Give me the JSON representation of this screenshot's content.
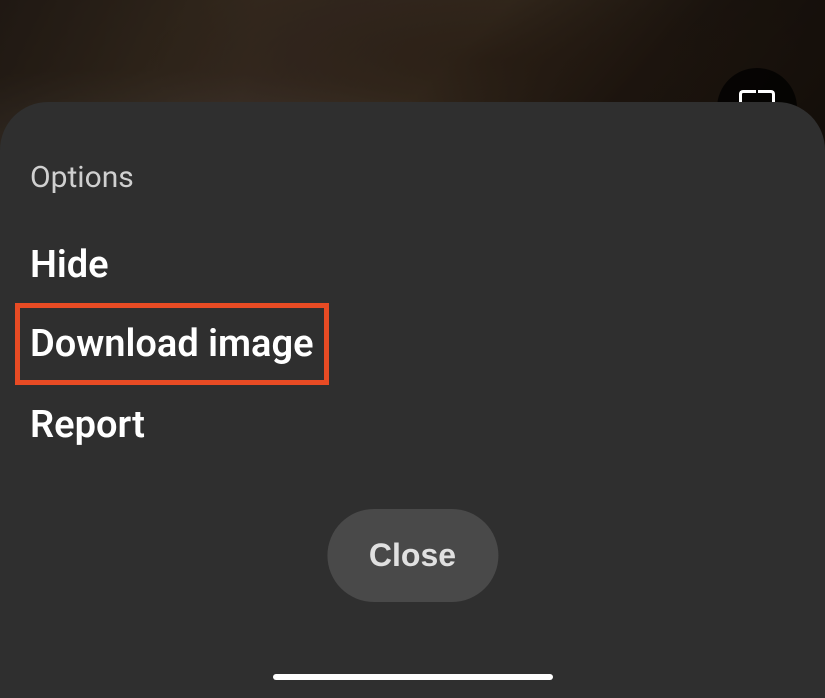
{
  "sheet": {
    "title": "Options",
    "options": [
      {
        "label": "Hide"
      },
      {
        "label": "Download image"
      },
      {
        "label": "Report"
      }
    ],
    "close_label": "Close"
  }
}
